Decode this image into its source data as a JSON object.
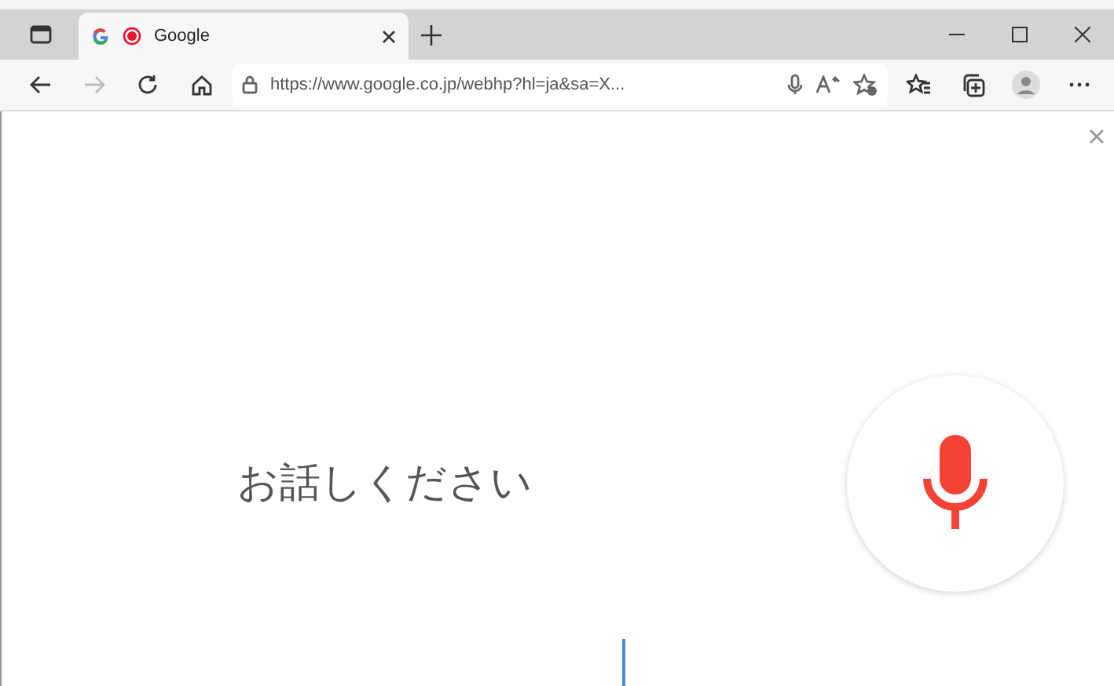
{
  "tab": {
    "title": "Google",
    "recording": true,
    "selected": true
  },
  "address_bar": {
    "url": "https://www.google.co.jp/webhp?hl=ja&sa=X..."
  },
  "forward_disabled": true,
  "voice_prompt": {
    "text": "お話しください",
    "listening": true
  }
}
